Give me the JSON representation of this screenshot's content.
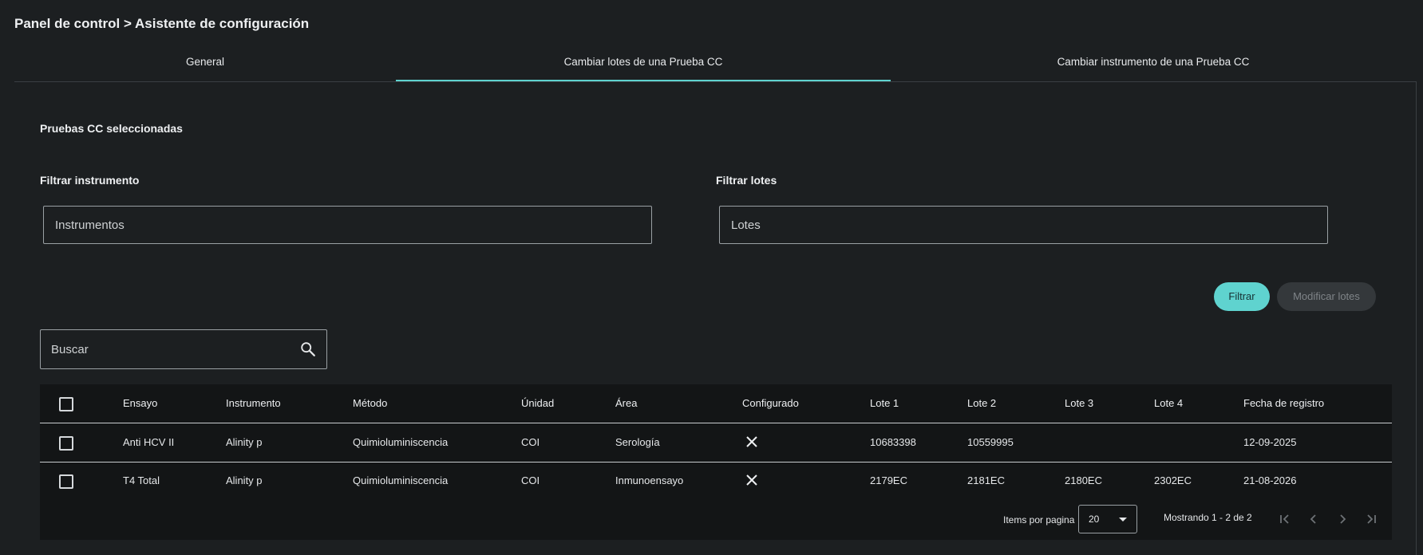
{
  "breadcrumb": "Panel de control > Asistente de configuración",
  "tabs": [
    {
      "label": "General"
    },
    {
      "label": "Cambiar lotes de una Prueba CC"
    },
    {
      "label": "Cambiar instrumento de una Prueba CC"
    }
  ],
  "section_title": "Pruebas CC seleccionadas",
  "filters": {
    "instrument_label": "Filtrar instrumento",
    "instrument_placeholder": "Instrumentos",
    "lots_label": "Filtrar lotes",
    "lots_placeholder": "Lotes"
  },
  "buttons": {
    "filter": "Filtrar",
    "modify_lots": "Modificar lotes"
  },
  "search": {
    "placeholder": "Buscar"
  },
  "table": {
    "headers": [
      "Ensayo",
      "Instrumento",
      "Método",
      "Únidad",
      "Área",
      "Configurado",
      "Lote 1",
      "Lote 2",
      "Lote 3",
      "Lote 4",
      "Fecha de registro"
    ],
    "rows": [
      {
        "ensayo": "Anti HCV II",
        "instrumento": "Alinity p",
        "metodo": "Quimioluminiscencia",
        "unidad": "COI",
        "area": "Serología",
        "configurado": "close-icon",
        "lote1": "10683398",
        "lote2": "10559995",
        "lote3": "",
        "lote4": "",
        "fecha": "12-09-2025"
      },
      {
        "ensayo": "T4 Total",
        "instrumento": "Alinity p",
        "metodo": "Quimioluminiscencia",
        "unidad": "COI",
        "area": "Inmunoensayo",
        "configurado": "close-icon",
        "lote1": "2179EC",
        "lote2": "2181EC",
        "lote3": "2180EC",
        "lote4": "2302EC",
        "fecha": "21-08-2026"
      }
    ]
  },
  "paginator": {
    "items_label": "Items por pagina",
    "page_size": "20",
    "range": "Mostrando 1 - 2 de 2"
  },
  "colors": {
    "background": "#1c1f21",
    "accent": "#5fd3cf",
    "table_bg": "#131516"
  }
}
